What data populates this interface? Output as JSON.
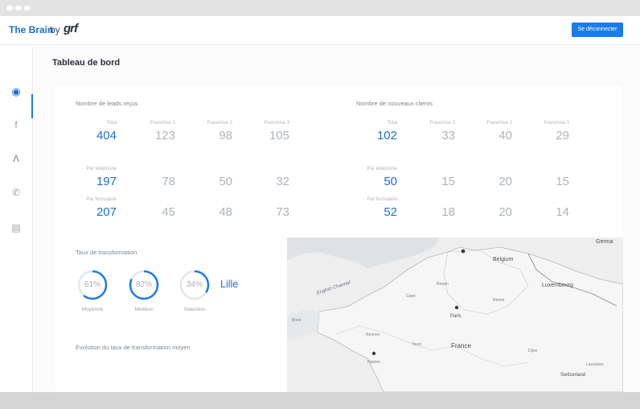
{
  "app": {
    "brand": "The Brain",
    "brand_by": "by",
    "brand_logo": "grf",
    "logout_label": "Se déconnecter"
  },
  "sidebar": {
    "items": [
      {
        "icon": "dashboard-icon",
        "glyph": "◉",
        "active": true
      },
      {
        "icon": "facebook-icon",
        "glyph": "f",
        "active": false
      },
      {
        "icon": "adwords-icon",
        "glyph": "Λ",
        "active": false
      },
      {
        "icon": "phone-icon",
        "glyph": "✆",
        "active": false
      },
      {
        "icon": "form-icon",
        "glyph": "▤",
        "active": false
      }
    ]
  },
  "page": {
    "title": "Tableau de bord"
  },
  "leads": {
    "title": "Nombre de leads reçus",
    "columns": [
      "Total",
      "Franchise 1",
      "Franchise 2",
      "Franchise 3"
    ],
    "total_row": [
      "404",
      "123",
      "98",
      "105"
    ],
    "phone_label": "Par téléphone",
    "phone_row": [
      "197",
      "78",
      "50",
      "32"
    ],
    "form_label": "Par formulaire",
    "form_row": [
      "207",
      "45",
      "48",
      "73"
    ]
  },
  "clients": {
    "title": "Nombre de nouveaux clients",
    "columns": [
      "Total",
      "Franchise 1",
      "Franchise 2",
      "Franchise 3"
    ],
    "total_row": [
      "102",
      "33",
      "40",
      "29"
    ],
    "phone_label": "Par téléphone",
    "phone_row": [
      "50",
      "15",
      "20",
      "15"
    ],
    "form_label": "Par formulaire",
    "form_row": [
      "52",
      "18",
      "20",
      "14"
    ]
  },
  "transformation": {
    "title": "Taux de transformation",
    "gauges": [
      {
        "label": "Moyenne",
        "pct_text": "61%",
        "value": 0.61
      },
      {
        "label": "Meilleur",
        "pct_text": "82%",
        "value": 0.82
      },
      {
        "label": "Sélection",
        "pct_text": "34%",
        "value": 0.34
      }
    ],
    "city": "Lille",
    "evolution_title": "Évolution du taux de transformation moyen"
  },
  "map": {
    "labels": {
      "germany": "Germa",
      "belgium": "Belgium",
      "luxembourg": "Luxembourg",
      "paris": "Paris",
      "france": "France",
      "channel": "English Channel",
      "switzerland": "Switzerland",
      "nantes": "Nantes",
      "rennes": "Rennes",
      "caen": "Caen",
      "rouen": "Rouen",
      "reims": "Reims",
      "tours": "Tours",
      "dijon": "Dijon",
      "lausanne": "Lausanne",
      "brest": "Brest"
    }
  },
  "colors": {
    "accent": "#1a7ce8",
    "gauge_track": "#e4e7ea",
    "muted_number": "#aeb5bd"
  }
}
